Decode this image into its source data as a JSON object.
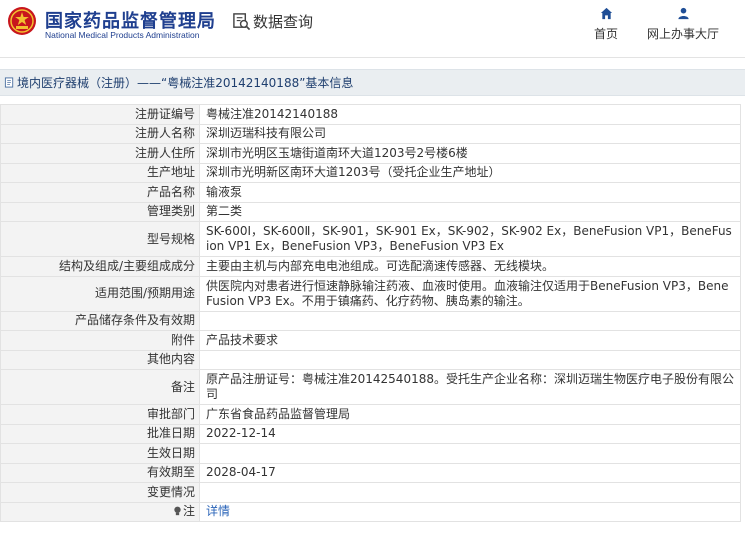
{
  "header": {
    "brand_title": "国家药品监督管理局",
    "brand_subtitle": "National Medical Products Administration",
    "query_label": "数据查询",
    "nav": [
      {
        "label": "首页",
        "icon": "home-icon"
      },
      {
        "label": "网上办事大厅",
        "icon": "user-icon"
      }
    ]
  },
  "breadcrumb": {
    "category": "境内医疗器械（注册）",
    "separator": "——",
    "current": "“粤械注准20142140188”基本信息"
  },
  "details": [
    {
      "label": "注册证编号",
      "value": "粤械注准20142140188"
    },
    {
      "label": "注册人名称",
      "value": "深圳迈瑞科技有限公司"
    },
    {
      "label": "注册人住所",
      "value": "深圳市光明区玉塘街道南环大道1203号2号楼6楼"
    },
    {
      "label": "生产地址",
      "value": "深圳市光明新区南环大道1203号（受托企业生产地址）"
    },
    {
      "label": "产品名称",
      "value": "输液泵"
    },
    {
      "label": "管理类别",
      "value": "第二类"
    },
    {
      "label": "型号规格",
      "value": "SK-600Ⅰ，SK-600Ⅱ，SK-901，SK-901 Ex，SK-902，SK-902 Ex，BeneFusion VP1，BeneFusion VP1 Ex，BeneFusion VP3，BeneFusion VP3 Ex"
    },
    {
      "label": "结构及组成/主要组成成分",
      "value": "主要由主机与内部充电电池组成。可选配滴速传感器、无线模块。"
    },
    {
      "label": "适用范围/预期用途",
      "value": "供医院内对患者进行恒速静脉输注药液、血液时使用。血液输注仅适用于BeneFusion VP3，BeneFusion VP3 Ex。不用于镇痛药、化疗药物、胰岛素的输注。"
    },
    {
      "label": "产品储存条件及有效期",
      "value": ""
    },
    {
      "label": "附件",
      "value": "产品技术要求"
    },
    {
      "label": "其他内容",
      "value": ""
    },
    {
      "label": "备注",
      "value": "原产品注册证号：粤械注准20142540188。受托生产企业名称：深圳迈瑞生物医疗电子股份有限公司"
    },
    {
      "label": "审批部门",
      "value": "广东省食品药品监督管理局"
    },
    {
      "label": "批准日期",
      "value": "2022-12-14"
    },
    {
      "label": "生效日期",
      "value": ""
    },
    {
      "label": "有效期至",
      "value": "2028-04-17"
    },
    {
      "label": "变更情况",
      "value": ""
    }
  ],
  "note_row": {
    "label": "注",
    "icon": "bulb-icon",
    "link_text": "详情"
  }
}
